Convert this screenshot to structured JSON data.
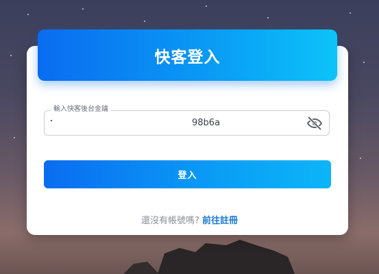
{
  "login": {
    "title": "快客登入",
    "field_label": "輸入快客後台金鑰",
    "field_value": "98b6a",
    "submit_label": "登入",
    "no_account_text": "還沒有帳號嗎?",
    "register_link": "前往註冊"
  },
  "icons": {
    "visibility_toggle": "eye-off-icon"
  },
  "colors": {
    "accent_start": "#0a6cf0",
    "accent_end": "#0cc3f8",
    "link": "#1877d6"
  }
}
